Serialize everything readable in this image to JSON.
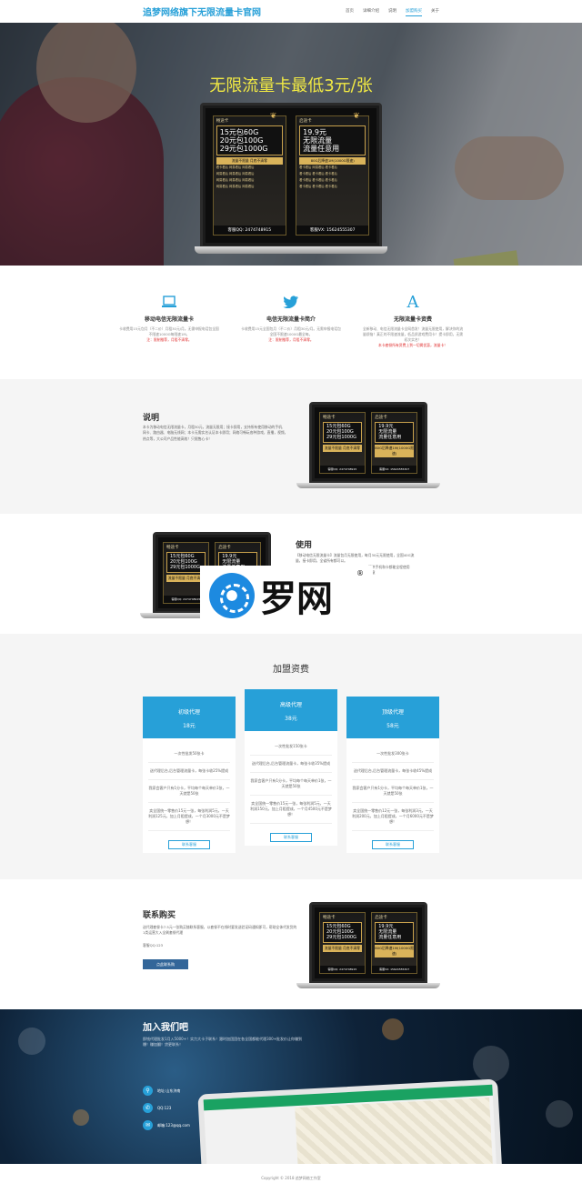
{
  "nav": {
    "brand": "追梦网络旗下无限流量卡官网",
    "links": [
      "首页",
      "详细介绍",
      "说明",
      "加盟购买",
      "关于"
    ],
    "active_index": 3
  },
  "hero": {
    "title": "无限流量卡最低3元/张",
    "badge": "ad图像",
    "card_left": {
      "title": "畅途卡",
      "lines": [
        "15元包60G",
        "20元包100G",
        "29元包1000G"
      ],
      "band": "流量不限量    月底不清零",
      "features": [
        "看卡看后  网易看后  网易看后",
        "网易看后  网易看后  网易看后",
        "网易看后  网易看后  网易看后",
        "网易看后  网易看后  网易看后"
      ],
      "tag": "客服QQ: 2474748915"
    },
    "card_right": {
      "title": "启途卡",
      "lines": [
        "19.9元",
        "无限流量",
        "流量任意用"
      ],
      "band": "80G后降速1M(1000G限速)",
      "features": [
        "看卡看后  网易看后  看卡看后",
        "看卡看后  看卡看后  看卡看后",
        "看卡看后  看卡看后  看卡看后",
        "看卡看后  看卡看后  看卡看后"
      ],
      "tag": "客服VX: 15624555307"
    }
  },
  "features": [
    {
      "icon": "laptop-icon",
      "title": "移动电信无限流量卡",
      "desc": "卡收费用15元包月（不二价）月租30元/月。无需申报电话包全国不限速1000G每限速1M。",
      "red": "注：限制推荐，月租不清零。"
    },
    {
      "icon": "twitter-icon",
      "title": "电信无限流量卡简介",
      "desc": "卡收费用15元全国包月（不二价）月租30元/月。无需申报电话包全国不限速1000G最全每。",
      "red": "注：限制推荐，月租不清零。"
    },
    {
      "icon": "letter-a-icon",
      "title": "无限流量卡资费",
      "desc": "全新移动、电信无限流量卡全网首发！流量无限使用，解决你的流量烦恼！真正的不限速流量，低品质游戏费用卡！提卡即用，无需初次实名！",
      "red": "本卡套餐所有资费上到一切属优惠，流量卡！"
    }
  ],
  "explain": {
    "title": "说明",
    "text": "本卡为移动电信无限流量卡，月租30元，流量无限用；接卡即用，支持所有使用移动的手机、网卡、路由器、电脑无线网；本卡无需实名认证本卡即用；网络可畅玩各种游戏，直播，视频，热点等，大公司产品性能高效！只限售心卡！"
  },
  "usage": {
    "title": "使用",
    "text_lines": [
      "【移动电信无限流量卡】流量包月无限使用，每月30元无限使用，全国40G流",
      "量，接卡即用，全省所有都可以。",
      "提供手机和卡都能全程使用",
      "注意"
    ]
  },
  "pricing": {
    "title": "加盟资费",
    "plans": [
      {
        "name": "初级代理",
        "price": "18元",
        "lines": [
          "一次性批发50张卡",
          "送代理后台,后台管理流量卡，每张卡收25%提成",
          "我家会客户只有1分卡，平均每个每天单价1张，一天就是50张",
          "卖全国统一零售价15元一张，每张利润5元，一天利润125元，加上月租提成，一个月3000元不是梦想！"
        ],
        "button": "联系客服"
      },
      {
        "name": "高级代理",
        "price": "38元",
        "lines": [
          "一次性批发150张卡",
          "送代理后台,后台管理流量卡，每张卡收35%提成",
          "我家会客户只有1分卡，平均每个每天单价1张，一天就是50张",
          "卖全国统一零售价15元一张，每张利润5元，一天利润150元，加上月租提成，一个月4500元不是梦想！"
        ],
        "button": "联系客服"
      },
      {
        "name": "顶级代理",
        "price": "58元",
        "lines": [
          "一次性批发300张卡",
          "送代理后台,后台管理流量卡，每张卡收45%提成",
          "我家会客户只有1分卡，平均每个每天单价1张，一天就是50张",
          "卖全国统一零售价12元一张，每张利润3元，一天利润200元，加上月租提成，一个月6000元不是梦想！"
        ],
        "button": "联系客服"
      }
    ]
  },
  "contact": {
    "title": "联系购买",
    "text": "送代理套餐卡7.5元一张购买随联系客服，以套餐不在线时要发送验证码通知即可，帮助全体代发货的1类运营大入全刷套餐代理",
    "qq": "客服QQ:123",
    "button": "点此联系购"
  },
  "join": {
    "title": "加入我们吧",
    "text": "即钱代理批发1月入5000+！实力大卡子联系！跟时加团团在各全国都能代理300+批发价让你赚到爆！赚加翻！贷更联系！",
    "rows": [
      {
        "icon": "location-icon",
        "text": "地址:山东济南"
      },
      {
        "icon": "phone-icon",
        "text": "QQ:123"
      },
      {
        "icon": "mail-icon",
        "text": "邮箱:123@qq.com"
      }
    ]
  },
  "footer": {
    "text": "Copyright © 2018 追梦网络工作室"
  },
  "watermark": {
    "text": "罗网",
    "reg": "®"
  }
}
